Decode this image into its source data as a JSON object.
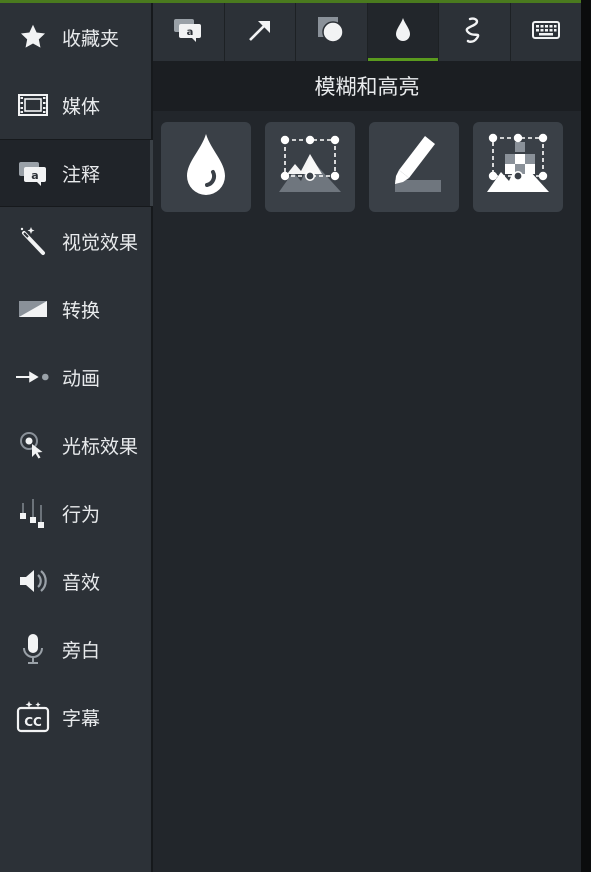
{
  "sidebar": {
    "items": [
      {
        "label": "收藏夹",
        "icon": "star-icon"
      },
      {
        "label": "媒体",
        "icon": "film-icon"
      },
      {
        "label": "注释",
        "icon": "annotation-icon",
        "selected": true
      },
      {
        "label": "视觉效果",
        "icon": "magic-wand-icon"
      },
      {
        "label": "转换",
        "icon": "transition-icon"
      },
      {
        "label": "动画",
        "icon": "animation-arrow-icon"
      },
      {
        "label": "光标效果",
        "icon": "cursor-effect-icon"
      },
      {
        "label": "行为",
        "icon": "behavior-icon"
      },
      {
        "label": "音效",
        "icon": "speaker-icon"
      },
      {
        "label": "旁白",
        "icon": "microphone-icon"
      },
      {
        "label": "字幕",
        "icon": "captions-icon"
      }
    ]
  },
  "tabs": [
    {
      "icon": "callout-icon"
    },
    {
      "icon": "arrow-icon"
    },
    {
      "icon": "shape-icon"
    },
    {
      "icon": "blur-drop-icon",
      "active": true
    },
    {
      "icon": "sketch-motion-icon"
    },
    {
      "icon": "keyboard-icon"
    }
  ],
  "main": {
    "section_title": "模糊和高亮"
  },
  "tiles": [
    {
      "icon": "blur-drop-icon"
    },
    {
      "icon": "spotlight-icon"
    },
    {
      "icon": "highlight-pen-icon"
    },
    {
      "icon": "pixelate-icon"
    }
  ],
  "colors": {
    "accent": "#5a9a1e",
    "sidebar_bg": "#2c3137",
    "panel_bg": "#22262b",
    "tile_bg": "#3a4047"
  }
}
